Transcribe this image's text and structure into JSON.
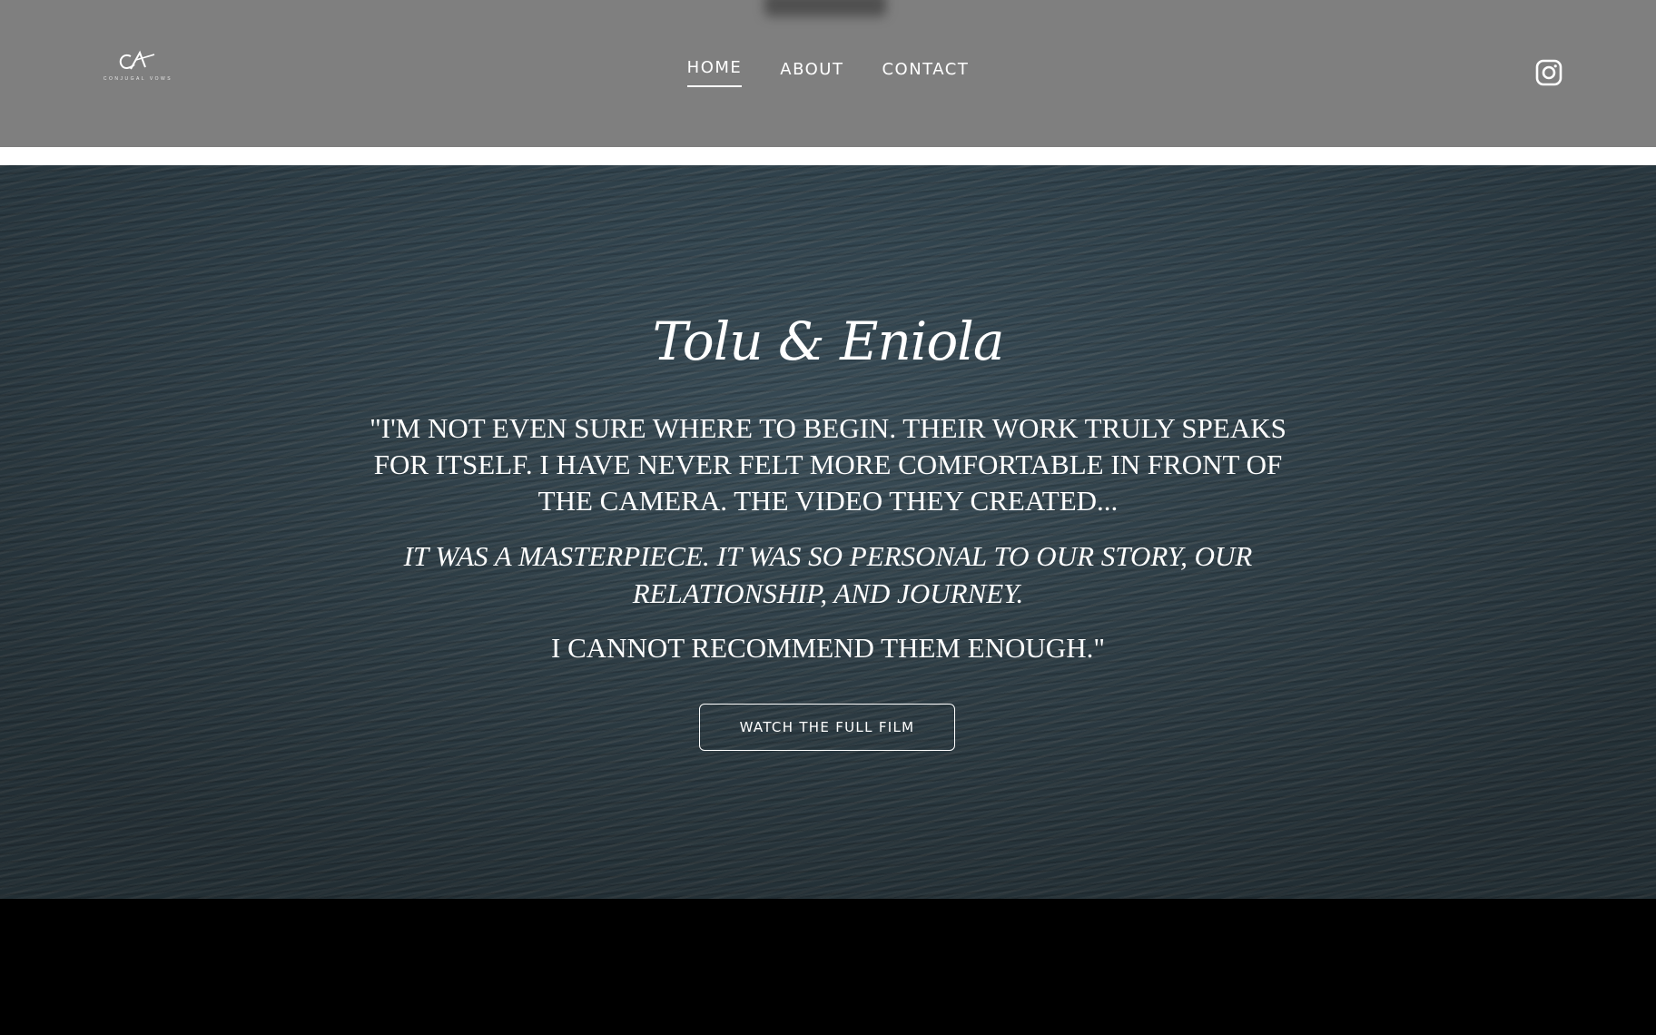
{
  "header": {
    "logo_mark": "CV",
    "logo_text": "Conjugal Vows",
    "nav": [
      {
        "label": "HOME",
        "active": true
      },
      {
        "label": "ABOUT",
        "active": false
      },
      {
        "label": "CONTACT",
        "active": false
      }
    ],
    "social_icon": "instagram-icon"
  },
  "hero": {
    "title": "Tolu & Eniola",
    "quote_1": "\"I'm not even sure where to begin. Their work truly speaks for itself. I have never felt more comfortable in front of the camera. The video they created...",
    "quote_2": "It was a masterpiece. It was so personal to our story, our relationship, and journey.",
    "quote_3": "I cannot recommend them enough.\"",
    "cta_label": "WATCH THE FULL FILM"
  },
  "colors": {
    "header_bg": "#7f7f7f",
    "hero_water": "#3a4e59",
    "text": "#ffffff",
    "footer_bg": "#000000"
  }
}
